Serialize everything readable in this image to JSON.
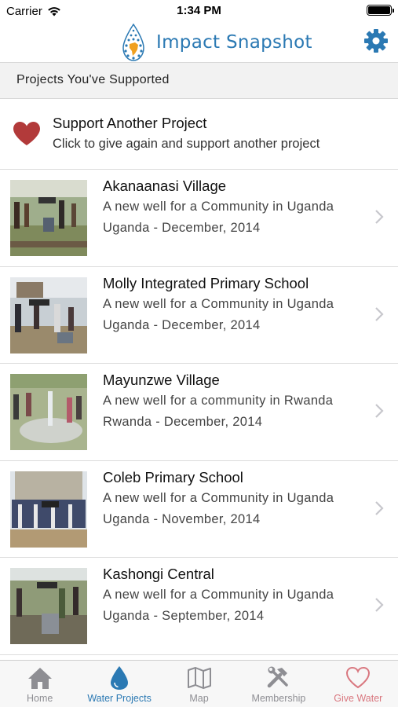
{
  "status_bar": {
    "carrier": "Carrier",
    "time": "1:34 PM"
  },
  "header": {
    "title": "Impact Snapshot",
    "logo_icon": "water-drop-africa-logo",
    "settings_icon": "gear-icon"
  },
  "section": {
    "title": "Projects You've Supported"
  },
  "support": {
    "icon": "heart-icon",
    "title": "Support Another Project",
    "subtitle": "Click to give again and support another project"
  },
  "projects": [
    {
      "name": "Akanaanasi Village",
      "description": "A new well for a Community in Uganda",
      "date": "Uganda - December, 2014"
    },
    {
      "name": "Molly Integrated Primary School",
      "description": "A new well for a Community in Uganda",
      "date": "Uganda - December, 2014"
    },
    {
      "name": "Mayunzwe Village",
      "description": "A new well for a community in Rwanda",
      "date": "Rwanda - December, 2014"
    },
    {
      "name": "Coleb Primary School",
      "description": "A new well for a Community in Uganda",
      "date": "Uganda - November, 2014"
    },
    {
      "name": "Kashongi Central",
      "description": "A new well for a Community in Uganda",
      "date": "Uganda - September, 2014"
    }
  ],
  "tabs": [
    {
      "label": "Home",
      "icon": "home-icon",
      "active": false
    },
    {
      "label": "Water Projects",
      "icon": "water-drop-icon",
      "active": true
    },
    {
      "label": "Map",
      "icon": "map-icon",
      "active": false
    },
    {
      "label": "Membership",
      "icon": "tools-icon",
      "active": false
    },
    {
      "label": "Give Water",
      "icon": "heart-outline-icon",
      "active": false
    }
  ],
  "colors": {
    "accent": "#2b79b3",
    "heart": "#b23a3a",
    "give_water": "#d9777f",
    "tab_inactive": "#8e8e93"
  }
}
